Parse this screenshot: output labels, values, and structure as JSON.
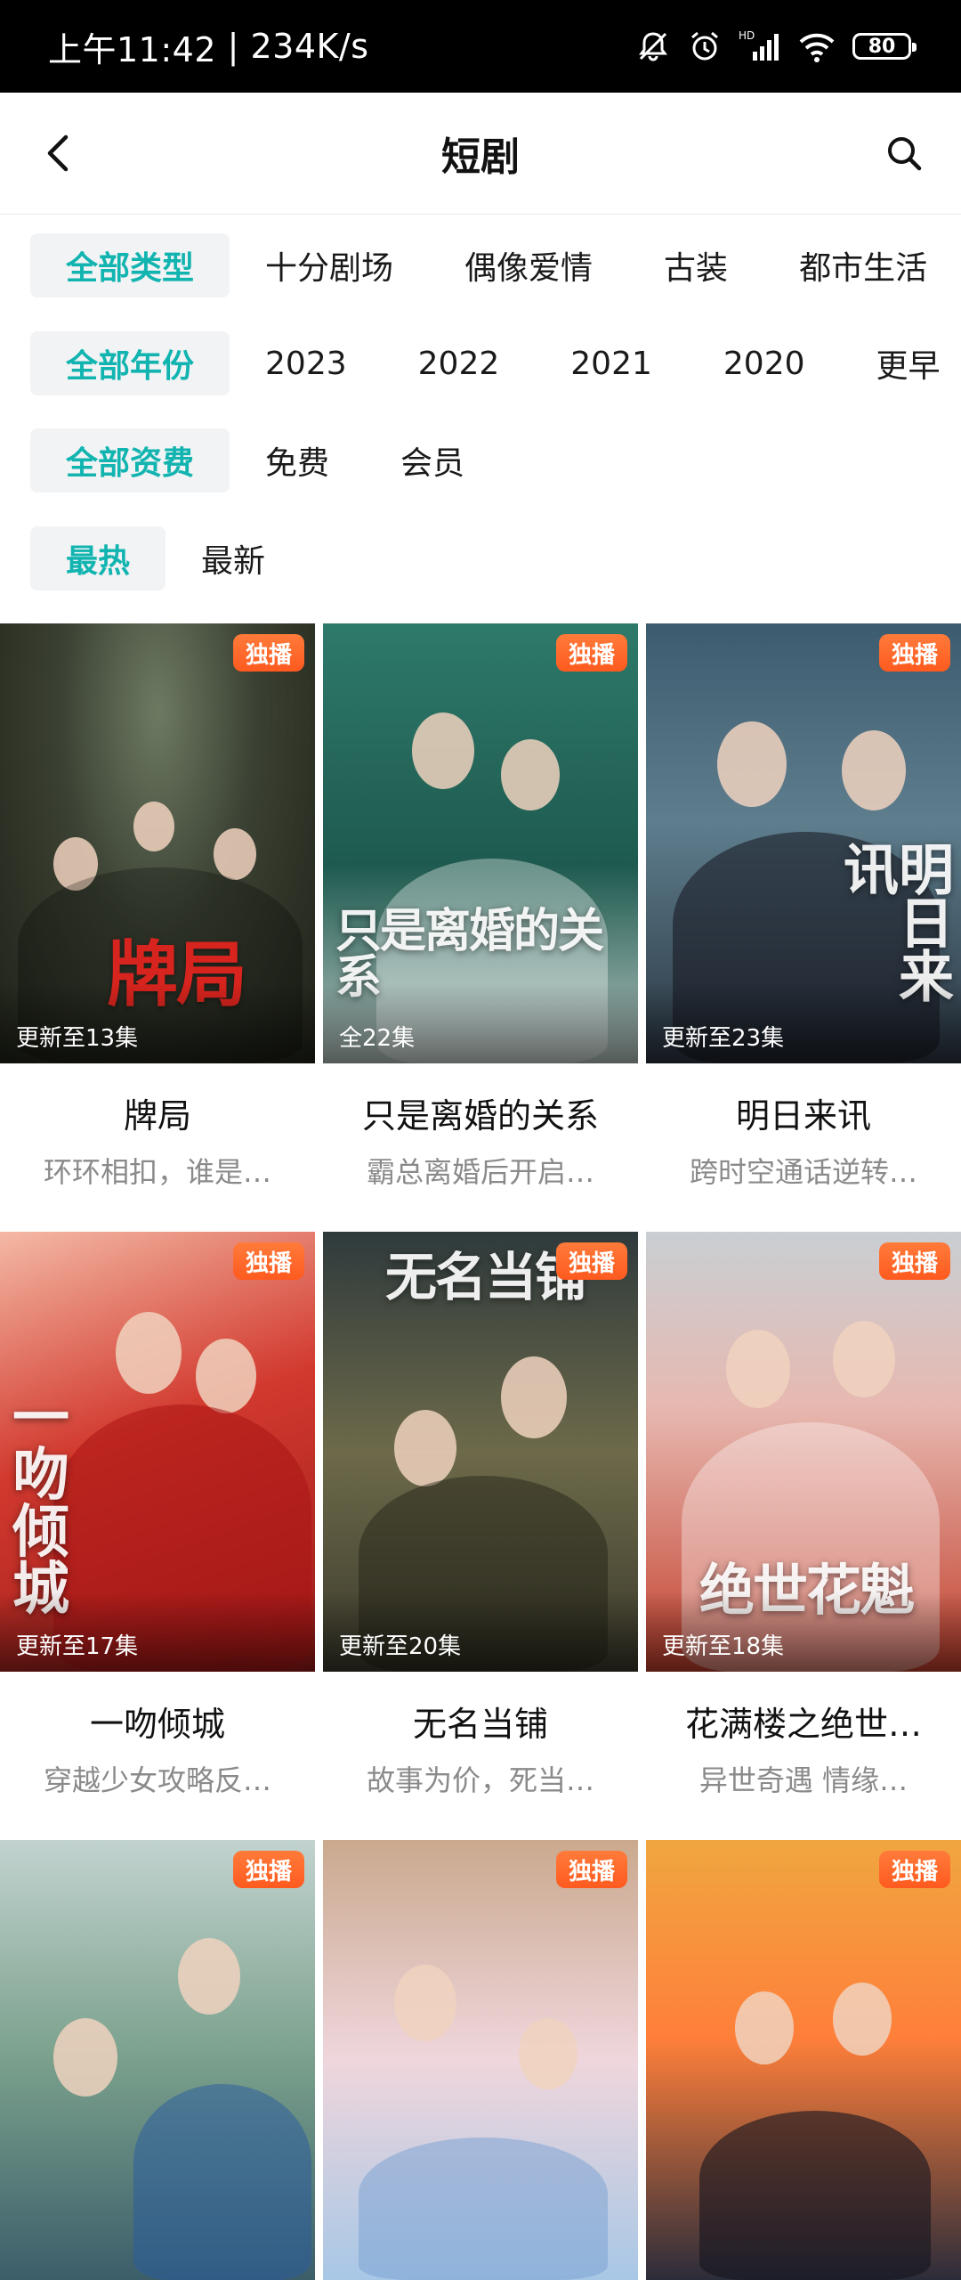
{
  "status_bar": {
    "time": "上午11:42",
    "net_speed": "234K/s",
    "battery": "80"
  },
  "header": {
    "title": "短剧"
  },
  "filters": {
    "type": {
      "active": "全部类型",
      "options": [
        "十分剧场",
        "偶像爱情",
        "古装",
        "都市生活"
      ]
    },
    "year": {
      "active": "全部年份",
      "options": [
        "2023",
        "2022",
        "2021",
        "2020",
        "更早"
      ]
    },
    "fee": {
      "active": "全部资费",
      "options": [
        "免费",
        "会员"
      ]
    },
    "sort": {
      "active": "最热",
      "options": [
        "最新"
      ]
    }
  },
  "badge_label": "独播",
  "shows": [
    {
      "title": "牌局",
      "desc": "环环相扣，谁是…",
      "episodes": "更新至13集",
      "art_title": "牌局"
    },
    {
      "title": "只是离婚的关系",
      "desc": "霸总离婚后开启…",
      "episodes": "全22集",
      "art_title": "只是离婚的关系"
    },
    {
      "title": "明日来讯",
      "desc": "跨时空通话逆转…",
      "episodes": "更新至23集",
      "art_title": "明日来讯"
    },
    {
      "title": "一吻倾城",
      "desc": "穿越少女攻略反…",
      "episodes": "更新至17集",
      "art_title": "一吻倾城"
    },
    {
      "title": "无名当铺",
      "desc": "故事为价，死当…",
      "episodes": "更新至20集",
      "art_title": "无名当铺"
    },
    {
      "title": "花满楼之绝世…",
      "desc": "异世奇遇 情缘…",
      "episodes": "更新至18集",
      "art_title": "绝世花魁"
    },
    {
      "title": "",
      "desc": "",
      "episodes": "",
      "art_title": ""
    },
    {
      "title": "",
      "desc": "",
      "episodes": "",
      "art_title": ""
    },
    {
      "title": "",
      "desc": "",
      "episodes": "",
      "art_title": ""
    }
  ]
}
